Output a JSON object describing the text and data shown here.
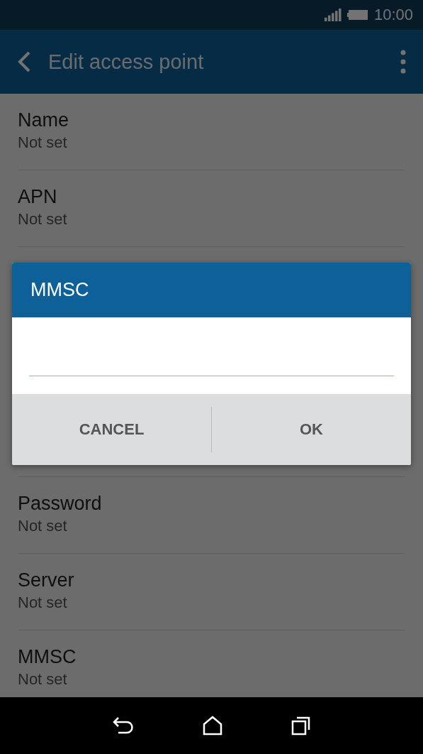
{
  "status_bar": {
    "time": "10:00"
  },
  "app_bar": {
    "title": "Edit access point"
  },
  "settings_top": [
    {
      "label": "Name",
      "value": "Not set"
    },
    {
      "label": "APN",
      "value": "Not set"
    }
  ],
  "settings_bottom": [
    {
      "label": "Password",
      "value": "Not set"
    },
    {
      "label": "Server",
      "value": "Not set"
    },
    {
      "label": "MMSC",
      "value": "Not set"
    }
  ],
  "dialog": {
    "title": "MMSC",
    "buttons": [
      {
        "label": "CANCEL"
      },
      {
        "label": "OK"
      }
    ]
  }
}
